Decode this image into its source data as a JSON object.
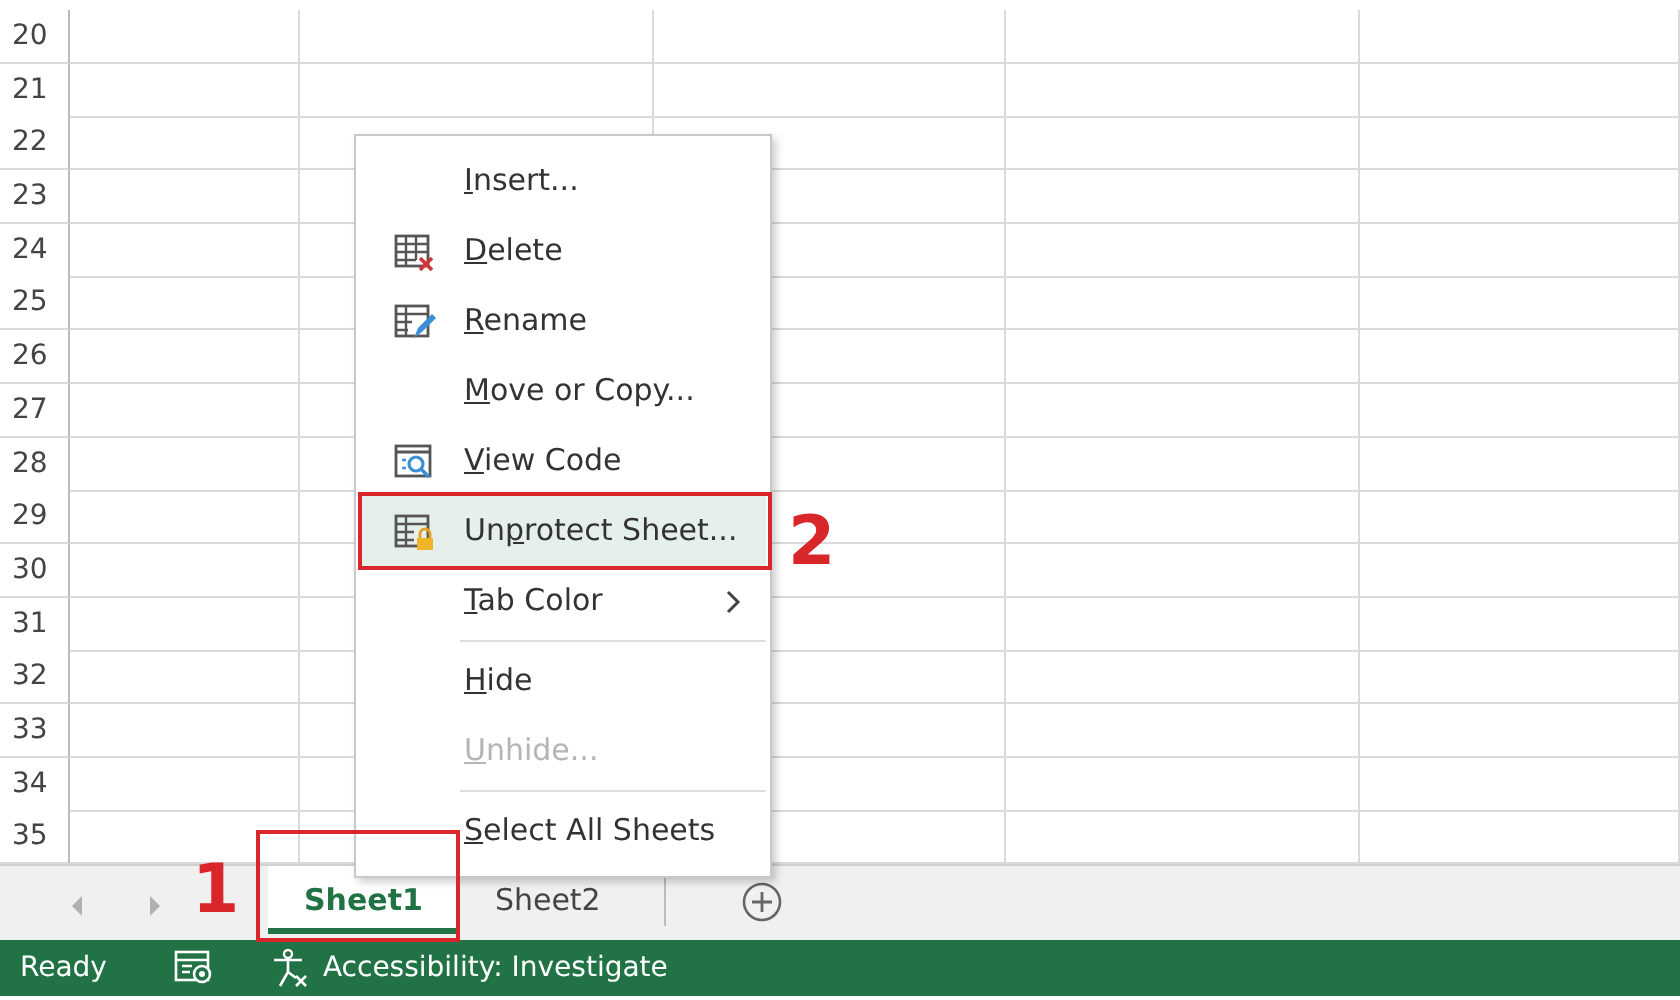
{
  "sheet": {
    "row_numbers": [
      "20",
      "21",
      "22",
      "23",
      "24",
      "25",
      "26",
      "27",
      "28",
      "29",
      "30",
      "31",
      "32",
      "33",
      "34",
      "35"
    ]
  },
  "context_menu": {
    "items": [
      {
        "kind": "item",
        "label": "Insert...",
        "selected": false,
        "disabled": false
      },
      {
        "kind": "item",
        "label": "Delete",
        "selected": false,
        "disabled": false
      },
      {
        "kind": "item",
        "label": "Rename",
        "selected": false,
        "disabled": false
      },
      {
        "kind": "item",
        "label": "Move or Copy...",
        "selected": false,
        "disabled": false
      },
      {
        "kind": "item",
        "label": "View Code",
        "selected": false,
        "disabled": false
      },
      {
        "kind": "item",
        "label": "Unprotect Sheet...",
        "selected": true,
        "disabled": false
      },
      {
        "kind": "submenu",
        "label": "Tab Color",
        "selected": false,
        "disabled": false
      },
      {
        "kind": "separator"
      },
      {
        "kind": "item",
        "label": "Hide",
        "selected": false,
        "disabled": false
      },
      {
        "kind": "item",
        "label": "Unhide...",
        "selected": false,
        "disabled": true
      },
      {
        "kind": "separator"
      },
      {
        "kind": "item",
        "label": "Select All Sheets",
        "selected": false,
        "disabled": false
      }
    ]
  },
  "sheet_tabs": [
    {
      "label": "Sheet1",
      "selected": true
    },
    {
      "label": "Sheet2",
      "selected": false
    }
  ],
  "annotations": [
    {
      "label": "1"
    },
    {
      "label": "2"
    }
  ],
  "status_bar": {
    "status": "Ready",
    "accessibility": "Accessibility: Investigate"
  }
}
